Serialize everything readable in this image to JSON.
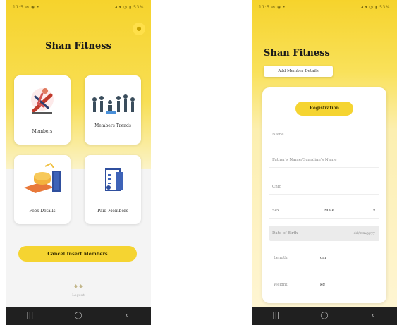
{
  "left": {
    "status_text": "11:5 ✉ ◉ •",
    "status_right": "◂ ▾ ◔ ▮ 53%",
    "title": "Shan Fitness",
    "cards": [
      {
        "label": "Members"
      },
      {
        "label": "Members Trends"
      },
      {
        "label": "Fees Details"
      },
      {
        "label": "Paid Members"
      }
    ],
    "cta_label": "Cancel Insert Members",
    "footer_icon": "♦♦",
    "footer_text": "Logout",
    "nav": [
      "|||",
      "◯",
      "‹"
    ]
  },
  "right": {
    "status_text": "11:5 ✉ ◉ •",
    "status_right": "◂ ▾ ◔ ▮ 53%",
    "title": "Shan Fitness",
    "add_button": "Add Member Details",
    "registration_label": "Registration",
    "fields": {
      "name": "Name",
      "father_name": "Father's Name/Guardian's Name",
      "cnic": "Cnic",
      "sex_label": "Sex",
      "sex_value": "Male",
      "dob_label": "Date of Birth",
      "dob_value": "dd/mm/yyyy",
      "length_label": "Length",
      "length_unit": "cm",
      "weight_label": "Weight",
      "weight_unit": "kg"
    },
    "nav": [
      "|||",
      "◯",
      "‹"
    ]
  },
  "colors": {
    "accent": "#f5d431",
    "navbar": "#202020"
  }
}
